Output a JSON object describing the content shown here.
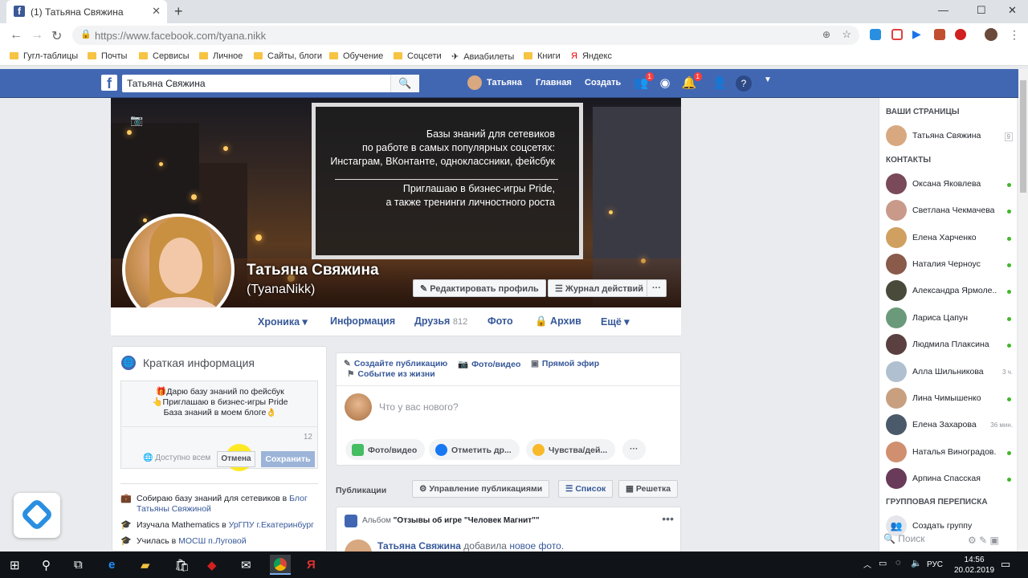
{
  "browser": {
    "tab_title": "(1) Татьяна Свяжина",
    "url_host": "https://www.facebook.com/",
    "url_path": "tyana.nikk",
    "bookmarks": [
      "Гугл-таблицы",
      "Почты",
      "Сервисы",
      "Личное",
      "Сайты, блоги",
      "Обучение",
      "Соцсети",
      "Авиабилеты",
      "Книги",
      "Яндекс"
    ]
  },
  "fb_header": {
    "search_value": "Татьяна Свяжина",
    "user_name": "Татьяна",
    "home": "Главная",
    "create": "Создать",
    "friend_badge": "1",
    "notif_badge": "1"
  },
  "cover": {
    "lines_top": [
      "Базы знаний для сетевиков",
      "по работе в самых популярных соцсетях:",
      "Инстаграм, ВКонтанте, одноклассники, фейсбук"
    ],
    "lines_bottom": [
      "Приглашаю в бизнес-игры Pride,",
      "а также тренинги личностного роста"
    ],
    "name": "Татьяна Свяжина",
    "nick": "(TyanaNikk)",
    "edit_profile": "Редактировать профиль",
    "activity_log": "Журнал действий",
    "more": "···"
  },
  "profile_nav": {
    "timeline": "Хроника ▾",
    "about": "Информация",
    "friends": "Друзья",
    "friends_count": "812",
    "photos": "Фото",
    "archive": "Архив",
    "more": "Ещё ▾"
  },
  "intro": {
    "title": "Краткая информация",
    "bio": [
      "🎁Дарю базу знаний по фейсбук",
      "👆Приглашаю в бизнес-игры Pride",
      "База знаний в моем блоге👌"
    ],
    "char_count": "12",
    "visibility": "Доступно всем",
    "cancel": "Отмена",
    "save": "Сохранить",
    "items": [
      {
        "pre": "Собираю базу знаний для сетевиков в ",
        "link": "Блог Татьяны Свяжиной"
      },
      {
        "pre": "Изучала Mathematics в ",
        "link": "УрГПУ г.Екатеринбург"
      },
      {
        "pre": "Училась в ",
        "link": "МОСШ п.Луговой"
      }
    ]
  },
  "composer": {
    "create_post": "Создайте публикацию",
    "photo_video": "Фото/видео",
    "live": "Прямой эфир",
    "life_event": "Событие из жизни",
    "placeholder": "Что у вас нового?",
    "pill_photo": "Фото/видео",
    "pill_tag": "Отметить др...",
    "pill_feel": "Чувства/дей...",
    "pill_more": "···"
  },
  "publications": {
    "header": "Публикации",
    "manage": "Управление публикациями",
    "list": "Список",
    "grid": "Решетка",
    "album_prefix": "Альбом ",
    "album_name": "\"Отзывы об игре \"Человек Магнит\"\"",
    "author": "Татьяна Свяжина",
    "action": "добавила",
    "object": "новое фото."
  },
  "sidebar": {
    "pages_header": "ВАШИ СТРАНИЦЫ",
    "page_name": "Татьяна Свяжина",
    "page_count": "9",
    "contacts_header": "КОНТАКТЫ",
    "contacts": [
      {
        "name": "Оксана Яковлева",
        "status": "online",
        "color": "#7a4a5a"
      },
      {
        "name": "Светлана Чекмачева",
        "status": "online",
        "color": "#c99a8a"
      },
      {
        "name": "Елена Харченко",
        "status": "online",
        "color": "#d0a060"
      },
      {
        "name": "Наталия Черноус",
        "status": "online",
        "color": "#8a5a4a"
      },
      {
        "name": "Александра Ярмоле...",
        "status": "online",
        "color": "#4a4a3a"
      },
      {
        "name": "Лариса Цапун",
        "status": "online",
        "color": "#6a9a7a"
      },
      {
        "name": "Людмила Плаксина",
        "status": "online",
        "color": "#5a4040"
      },
      {
        "name": "Алла Шильникова",
        "status": "3 ч.",
        "color": "#b0c0d0"
      },
      {
        "name": "Лина Чимышенко",
        "status": "online",
        "color": "#c8a080"
      },
      {
        "name": "Елена Захарова",
        "status": "36 мин.",
        "color": "#4a5a6a"
      },
      {
        "name": "Наталья Виноградов...",
        "status": "online",
        "color": "#d09070"
      },
      {
        "name": "Арпина Спасская",
        "status": "online",
        "color": "#6a3a5a"
      }
    ],
    "group_header": "ГРУППОВАЯ ПЕРЕПИСКА",
    "create_group": "Создать группу",
    "search": "Поиск"
  },
  "taskbar": {
    "lang": "РУС",
    "time": "14:56",
    "date": "20.02.2019"
  }
}
